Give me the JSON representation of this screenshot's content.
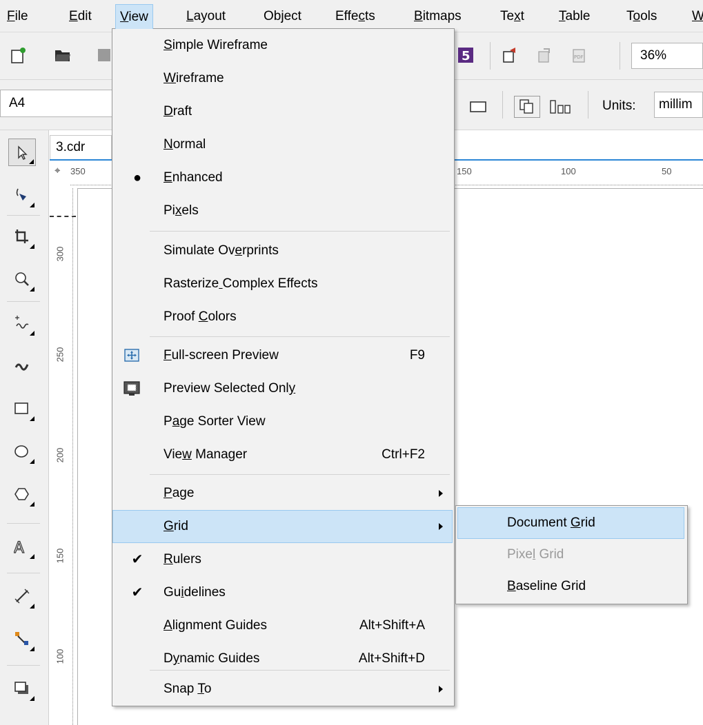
{
  "menubar": {
    "items": [
      "File",
      "Edit",
      "View",
      "Layout",
      "Object",
      "Effects",
      "Bitmaps",
      "Text",
      "Table",
      "Tools",
      "W"
    ]
  },
  "toolbar": {
    "zoom_value": "36%",
    "page_size": "A4",
    "units_label": "Units:",
    "units_value": "millim"
  },
  "document": {
    "tab_title": "3.cdr",
    "h_ruler_labels": [
      "350",
      "150",
      "100",
      "50"
    ],
    "v_ruler_labels": [
      "300",
      "250",
      "200",
      "150",
      "100"
    ]
  },
  "view_menu": {
    "items": [
      {
        "label": "Simple Wireframe",
        "shortcut": "",
        "submenu": false
      },
      {
        "label": "Wireframe",
        "shortcut": "",
        "submenu": false
      },
      {
        "label": "Draft",
        "shortcut": "",
        "submenu": false
      },
      {
        "label": "Normal",
        "shortcut": "",
        "submenu": false
      },
      {
        "label": "Enhanced",
        "shortcut": "",
        "submenu": false,
        "mark": "●"
      },
      {
        "label": "Pixels",
        "shortcut": "",
        "submenu": false
      },
      {
        "label": "Simulate Overprints",
        "shortcut": "",
        "submenu": false
      },
      {
        "label": "Rasterize Complex Effects",
        "shortcut": "",
        "submenu": false
      },
      {
        "label": "Proof Colors",
        "shortcut": "",
        "submenu": false
      },
      {
        "label": "Full-screen Preview",
        "shortcut": "F9",
        "submenu": false,
        "icon": "fullscreen-preview-icon"
      },
      {
        "label": "Preview Selected Only",
        "shortcut": "",
        "submenu": false,
        "icon": "preview-selected-icon"
      },
      {
        "label": "Page Sorter View",
        "shortcut": "",
        "submenu": false
      },
      {
        "label": "View Manager",
        "shortcut": "Ctrl+F2",
        "submenu": false
      },
      {
        "label": "Page",
        "shortcut": "",
        "submenu": true
      },
      {
        "label": "Grid",
        "shortcut": "",
        "submenu": true,
        "highlighted": true
      },
      {
        "label": "Rulers",
        "shortcut": "",
        "submenu": false,
        "mark": "✔"
      },
      {
        "label": "Guidelines",
        "shortcut": "",
        "submenu": false,
        "mark": "✔"
      },
      {
        "label": "Alignment Guides",
        "shortcut": "Alt+Shift+A",
        "submenu": false
      },
      {
        "label": "Dynamic Guides",
        "shortcut": "Alt+Shift+D",
        "submenu": false
      },
      {
        "label": "Snap To",
        "shortcut": "",
        "submenu": true
      }
    ]
  },
  "grid_menu": {
    "items": [
      {
        "label": "Document Grid",
        "enabled": true,
        "highlighted": true
      },
      {
        "label": "Pixel Grid",
        "enabled": false
      },
      {
        "label": "Baseline Grid",
        "enabled": true
      }
    ]
  },
  "colors": {
    "highlight_bg": "#cce4f7",
    "highlight_border": "#99c9ef",
    "menu_bg": "#f2f2f2",
    "tab_accent": "#2c86d6"
  }
}
